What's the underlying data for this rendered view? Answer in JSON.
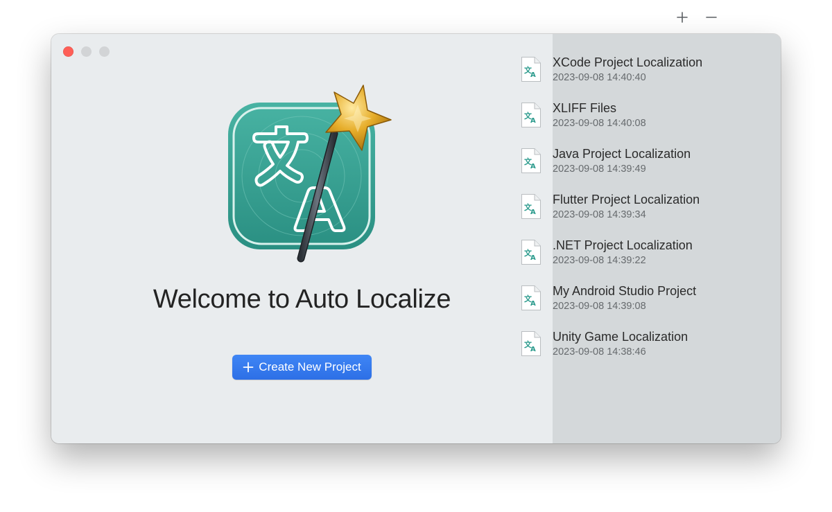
{
  "window": {
    "traffic_lights": [
      "close",
      "minimize",
      "zoom"
    ]
  },
  "welcome": {
    "title": "Welcome to Auto Localize",
    "app_icon": "translate-wand-icon",
    "create_button_label": "Create New Project",
    "create_button_icon": "plus-icon"
  },
  "recent": {
    "add_icon": "plus-icon",
    "remove_icon": "minus-icon",
    "items": [
      {
        "title": "XCode Project Localization",
        "date": "2023-09-08 14:40:40",
        "icon": "translation-file-icon"
      },
      {
        "title": "XLIFF Files",
        "date": "2023-09-08 14:40:08",
        "icon": "translation-file-icon"
      },
      {
        "title": "Java Project Localization",
        "date": "2023-09-08 14:39:49",
        "icon": "translation-file-icon"
      },
      {
        "title": "Flutter Project Localization",
        "date": "2023-09-08 14:39:34",
        "icon": "translation-file-icon"
      },
      {
        "title": ".NET Project Localization",
        "date": "2023-09-08 14:39:22",
        "icon": "translation-file-icon"
      },
      {
        "title": "My Android Studio Project",
        "date": "2023-09-08 14:39:08",
        "icon": "translation-file-icon"
      },
      {
        "title": "Unity Game Localization",
        "date": "2023-09-08 14:38:46",
        "icon": "translation-file-icon"
      }
    ]
  },
  "colors": {
    "accent": "#2d6fe6",
    "close_light": "#fe5f57",
    "icon_teal": "#2a9a8c",
    "star_gold": "#e0a623"
  }
}
